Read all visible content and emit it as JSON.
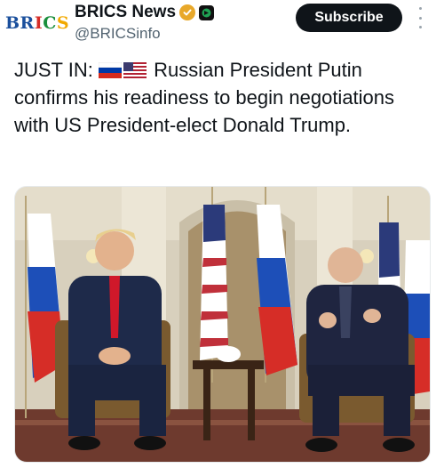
{
  "account": {
    "avatar_letters": [
      "B",
      "R",
      "I",
      "C",
      "S"
    ],
    "display_name": "BRICS News",
    "handle": "@BRICSinfo",
    "verified_badge": "gold-verified-icon",
    "affiliate_badge": "affiliate-icon"
  },
  "actions": {
    "subscribe_label": "Subscribe",
    "more_icon": "more-vertical-icon"
  },
  "tweet": {
    "prefix": "JUST IN:",
    "flags": [
      "russia-flag",
      "usa-flag"
    ],
    "text": "Russian President Putin confirms his readiness to begin negotiations with US President-elect Donald Trump."
  },
  "media": {
    "kind": "photo"
  },
  "colors": {
    "subscribe_bg": "#0f1419",
    "verified_gold": "#e8a82a",
    "handle_gray": "#536471"
  }
}
